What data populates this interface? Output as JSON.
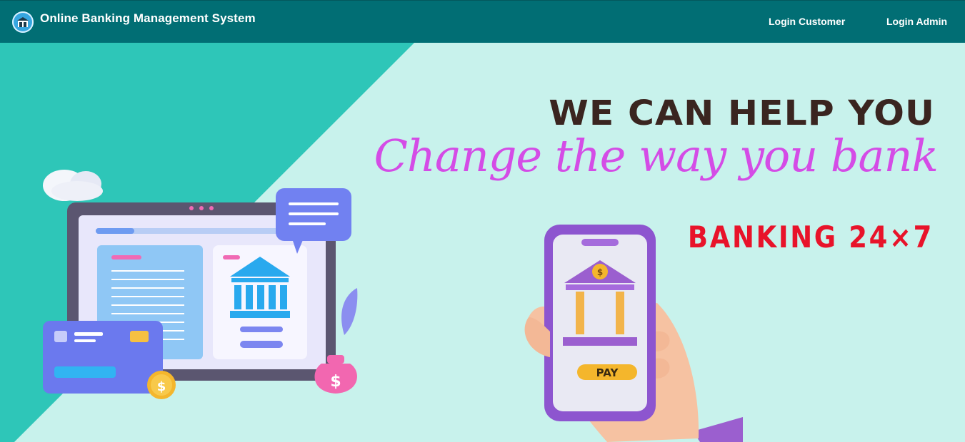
{
  "header": {
    "title": "Online Banking Management System",
    "logo_icon": "bank-building-icon",
    "nav": [
      {
        "label": "Login Customer"
      },
      {
        "label": "Login Admin"
      }
    ]
  },
  "hero": {
    "headline": "WE CAN HELP YOU",
    "tagline": "Change the way you bank",
    "availability": "BANKING 24×7",
    "phone_pay_label": "PAY",
    "phone_coin_symbol": "$",
    "card_coin_symbol": "$",
    "money_bag_symbol": "$"
  },
  "colors": {
    "navbar": "#016e74",
    "hero_background": "#c8f2ec",
    "hero_diagonal": "#2ec6b8",
    "headline": "#3a2520",
    "tagline": "#d44ce6",
    "availability": "#e8132a"
  }
}
